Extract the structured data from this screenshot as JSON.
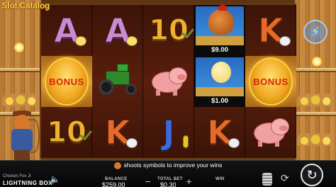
{
  "logo": {
    "text": "Slot Catalog"
  },
  "reels": {
    "reel1": {
      "row1": "A",
      "row2": "BONUS",
      "row3": "10"
    },
    "reel2": {
      "row1": "A",
      "row2": "tractor",
      "row3": "K"
    },
    "reel3": {
      "row1": "10",
      "row2": "pig",
      "row3": "J"
    },
    "reel4": {
      "row1_prize": "$9.00",
      "row2_prize": "$1.00",
      "row3": "K"
    },
    "reel5": {
      "row1": "K",
      "row2": "BONUS",
      "row3": "pig"
    }
  },
  "marquee": {
    "text": "shoots symbols to improve your wins"
  },
  "footer": {
    "game_name": "Chicken Fox Jr",
    "brand": "LIGHTNING BOX",
    "balance_label": "BALANCE",
    "balance_value": "$259.00",
    "total_bet_label": "TOTAL BET",
    "total_bet_value": "$0.30",
    "win_label": "WIN"
  },
  "icons": {
    "sound": "speaker-icon",
    "bet_minus": "minus-icon",
    "bet_plus": "plus-icon",
    "coins": "coin-stack-icon",
    "autoplay": "autoplay-icon",
    "spin": "spin-icon",
    "bolt": "lightning-icon"
  },
  "colors": {
    "bonus_text": "#d8240c",
    "prize_bg": "#0c0c0c",
    "reel_bg": "#3a1408"
  }
}
